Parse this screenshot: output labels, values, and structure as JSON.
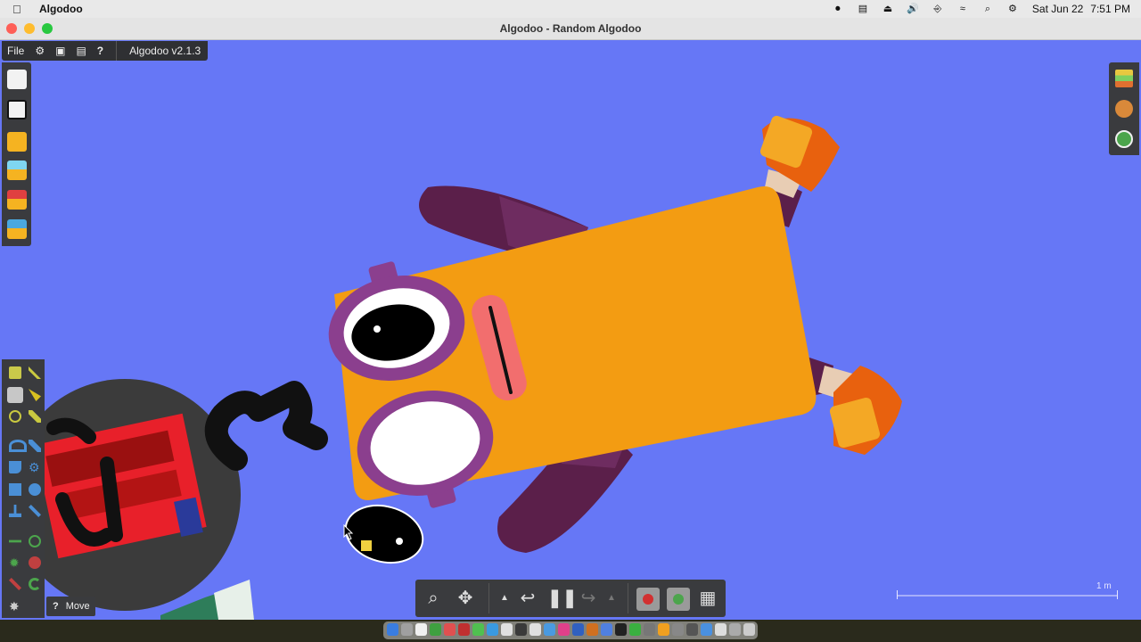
{
  "menubar": {
    "app_name": "Algodoo",
    "date": "Sat Jun 22",
    "time": "7:51 PM"
  },
  "window": {
    "title": "Algodoo - Random Algodoo"
  },
  "toolbar": {
    "file_label": "File",
    "help_label": "?",
    "version": "Algodoo v2.1.3"
  },
  "tool_tip": {
    "icon": "?",
    "label": "Move"
  },
  "scale": {
    "label": "1 m"
  },
  "colors": {
    "canvas": "#6677f6",
    "body": "#f39c12",
    "arm": "#5b1f4a",
    "glasses": "#8b3f8e",
    "shoe": "#e8610e",
    "panel": "#3a3b3e"
  },
  "icons": {
    "left_panel": [
      "new-scene-icon",
      "scene-list-icon",
      "open-folder-icon",
      "phunlet-folder-icon",
      "scene-folder-icon",
      "gallery-folder-icon"
    ],
    "right_panel": [
      "layers-icon",
      "palette-icon",
      "info-icon"
    ],
    "bottom_toolbar": [
      "zoom-icon",
      "pan-icon",
      "undo-menu-icon",
      "undo-icon",
      "pause-icon",
      "redo-icon",
      "redo-menu-icon",
      "gravity-icon",
      "air-icon",
      "grid-icon"
    ]
  }
}
